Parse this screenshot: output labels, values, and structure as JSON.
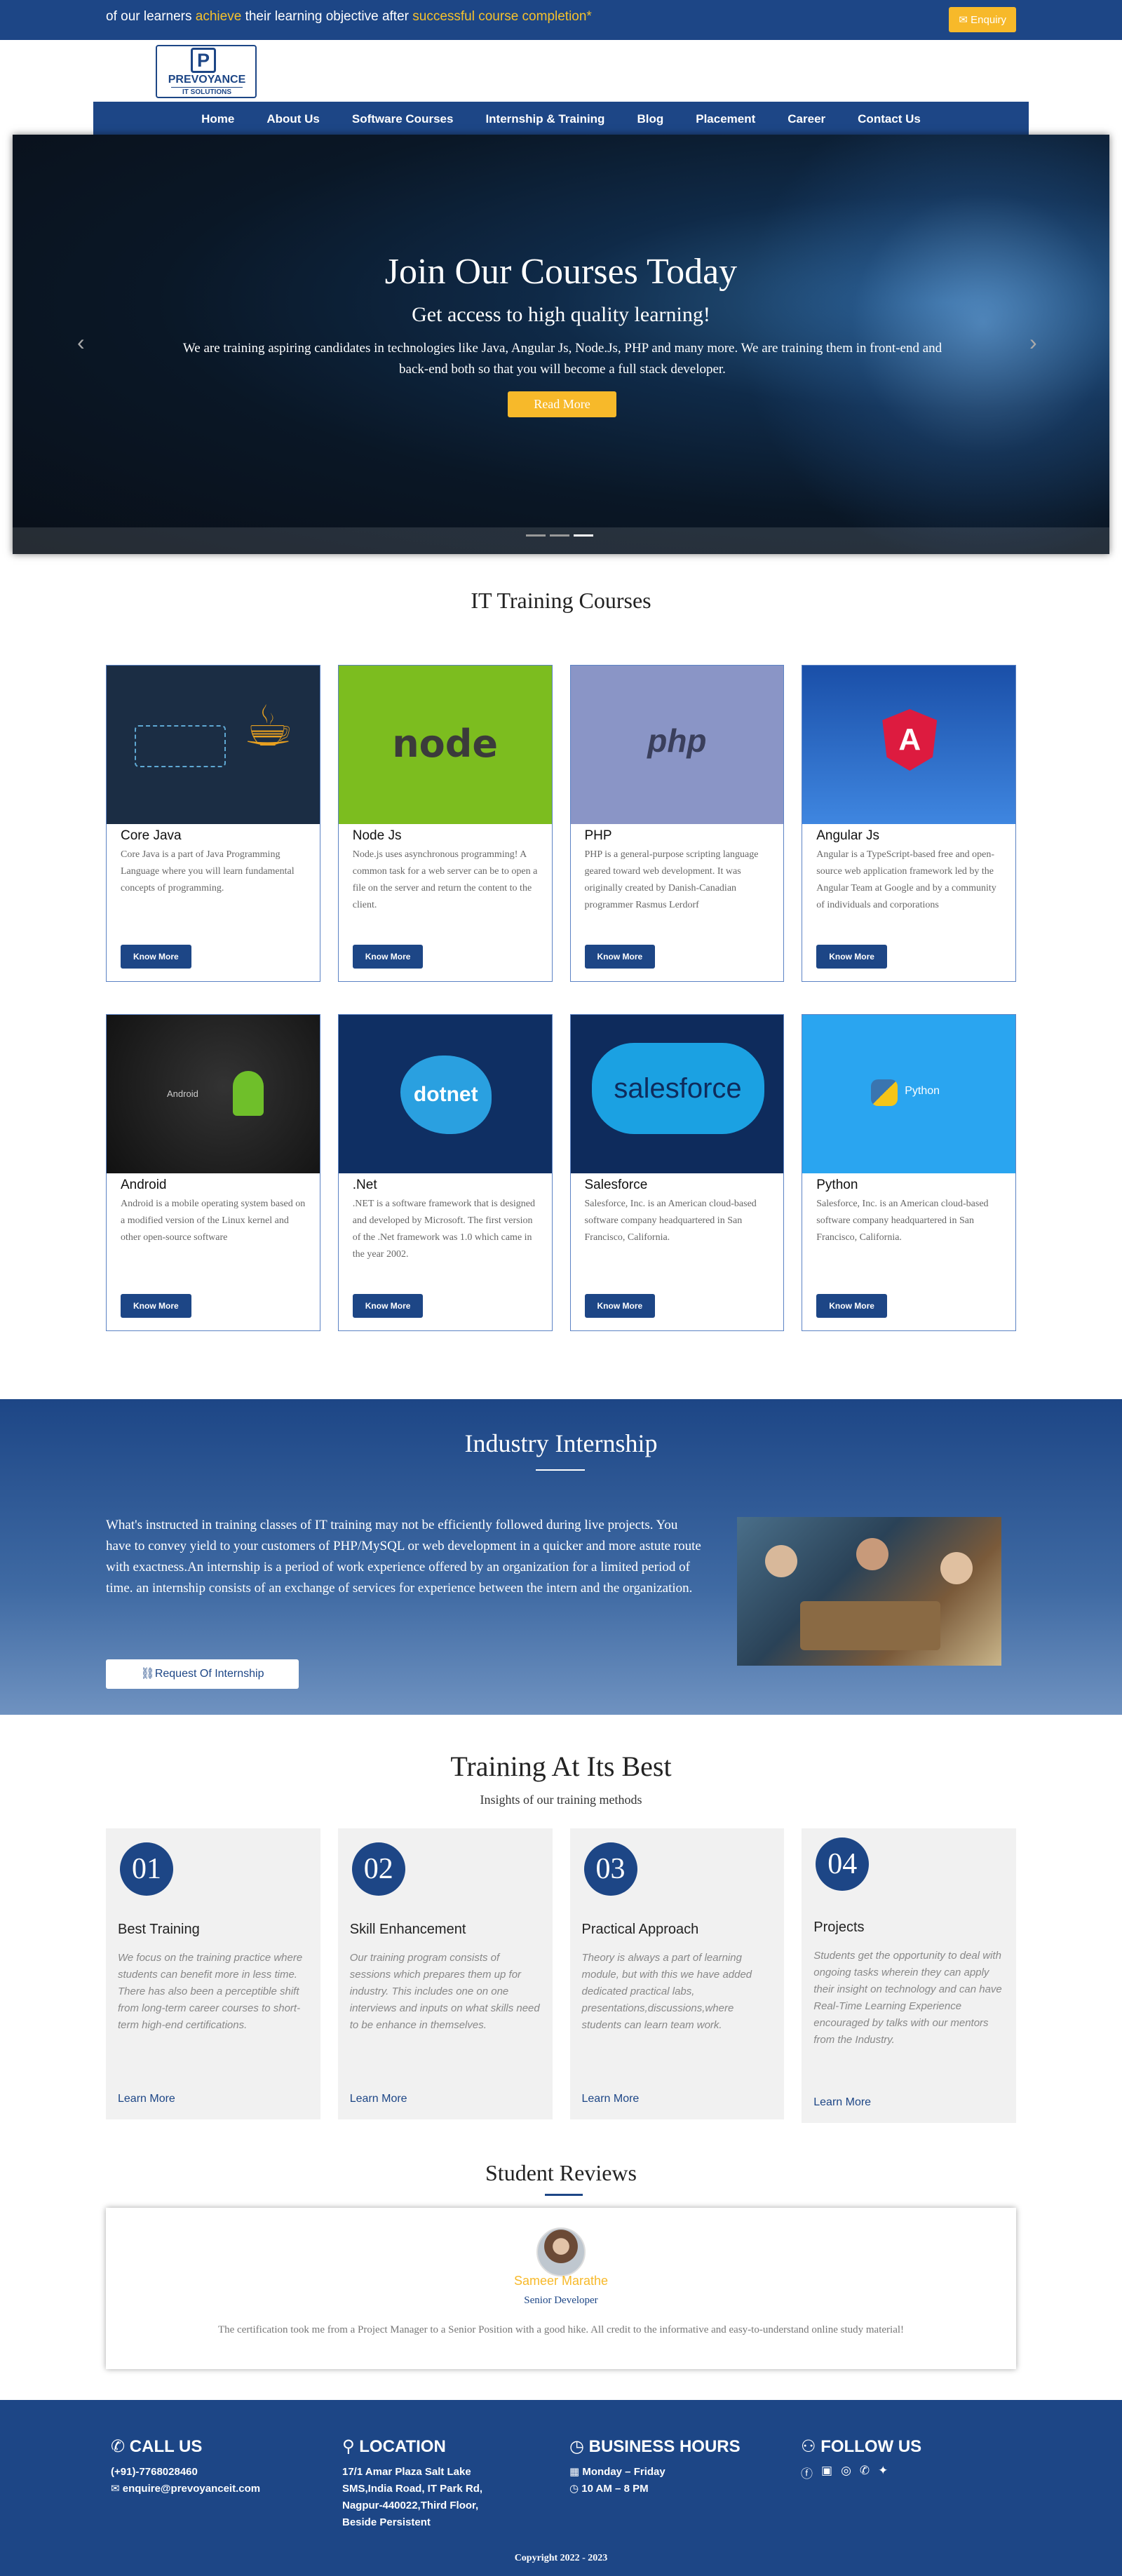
{
  "topbar": {
    "msg_a": "of our learners ",
    "msg_hl1": "achieve",
    "msg_b": " their learning objective after ",
    "msg_hl2": "successful course completion*",
    "enquiry": "✉ Enquiry"
  },
  "logo": {
    "letter": "P",
    "line1": "PREVOYANCE",
    "line2": "IT SOLUTIONS"
  },
  "nav": [
    "Home",
    "About Us",
    "Software Courses",
    "Internship & Training",
    "Blog",
    "Placement",
    "Career",
    "Contact Us"
  ],
  "hero": {
    "title": "Join Our Courses Today",
    "subtitle": "Get access to high quality learning!",
    "text": "We are training aspiring candidates in technologies like Java, Angular Js, Node.Js, PHP and many more. We are training them in front-end and back-end both so that you will become a full stack developer.",
    "button": "Read More",
    "prev": "‹",
    "next": "›"
  },
  "courses_title": "IT Training Courses",
  "courses": [
    {
      "title": "Core Java",
      "desc": "Core Java is a part of Java Programming Language where you will learn fundamental concepts of programming.",
      "btn": "Know More",
      "img_text": "",
      "bg": "#1b2d44"
    },
    {
      "title": "Node Js",
      "desc": "Node.js uses asynchronous programming! A common task for a web server can be to open a file on the server and return the content to the client.",
      "btn": "Know More",
      "img_text": "node",
      "bg": "#7cbd1f"
    },
    {
      "title": "PHP",
      "desc": "PHP is a general-purpose scripting language geared toward web development. It was originally created by Danish-Canadian programmer Rasmus Lerdorf",
      "btn": "Know More",
      "img_text": "php",
      "bg": "#8a95c6"
    },
    {
      "title": "Angular Js",
      "desc": "Angular is a TypeScript-based free and open-source web application framework led by the Angular Team at Google and by a community of individuals and corporations",
      "btn": "Know More",
      "img_text": "A",
      "bg": "#2a64c0"
    },
    {
      "title": "Android",
      "desc": "Android is a mobile operating system based on a modified version of the Linux kernel and other open-source software",
      "btn": "Know More",
      "img_text": "Android",
      "bg": "#151515"
    },
    {
      "title": ".Net",
      "desc": ".NET is a software framework that is designed and developed by Microsoft. The first version of the .Net framework was 1.0 which came in the year 2002.",
      "btn": "Know More",
      "img_text": "dotnet",
      "bg": "#0f2f63"
    },
    {
      "title": "Salesforce",
      "desc": "Salesforce, Inc. is an American cloud-based software company headquartered in San Francisco, California.",
      "btn": "Know More",
      "img_text": "salesforce",
      "bg": "#0e2b5c"
    },
    {
      "title": "Python",
      "desc": "Salesforce, Inc. is an American cloud-based software company headquartered in San Francisco, California.",
      "btn": "Know More",
      "img_text": "Python",
      "bg": "#2aa5f0"
    }
  ],
  "internship": {
    "title": "Industry Internship",
    "text": "What's instructed in training classes of IT training may not be efficiently followed during live projects. You have to convey yield to your customers of PHP/MySQL or web development in a quicker and more astute route with exactness.An internship is a period of work experience offered by an organization for a limited period of time. an internship consists of an exchange of services for experience between the intern and the organization.",
    "button": "⛓Request Of Internship"
  },
  "best": {
    "title": "Training At Its Best",
    "subtitle": "Insights of our training methods",
    "items": [
      {
        "num": "01",
        "title": "Best Training",
        "desc": "We focus on the training practice where students can benefit more in less time. There has also been a perceptible shift from long-term career courses to short-term high-end certifications.",
        "link": "Learn More"
      },
      {
        "num": "02",
        "title": "Skill Enhancement",
        "desc": "Our training program consists of sessions which prepares them up for industry. This includes one on one interviews and inputs on what skills need to be enhance in themselves.",
        "link": "Learn More"
      },
      {
        "num": "03",
        "title": "Practical Approach",
        "desc": "Theory is always a part of learning module, but with this we have added dedicated practical labs, presentations,discussions,where students can learn team work.",
        "link": "Learn More"
      },
      {
        "num": "04",
        "title": "Projects",
        "desc": "Students get the opportunity to deal with ongoing tasks wherein they can apply their insight on technology and can have Real-Time Learning Experience encouraged by talks with our mentors from the Industry.",
        "link": "Learn More"
      }
    ]
  },
  "reviews": {
    "title": "Student Reviews",
    "name": "Sameer Marathe",
    "role": "Senior Developer",
    "text": "The certification took me from a Project Manager to a Senior Position with a good hike. All credit to the informative and easy-to-understand online study material!"
  },
  "footer": {
    "call_title": "CALL US",
    "phone": "(+91)-7768028460",
    "email": "enquire@prevoyanceit.com",
    "loc_title": "LOCATION",
    "address": [
      "17/1 Amar Plaza Salt Lake",
      "SMS,India Road, IT Park Rd,",
      "Nagpur-440022,Third Floor,",
      "Beside Persistent"
    ],
    "hours_title": "BUSINESS HOURS",
    "days": "Monday – Friday",
    "time": "10 AM – 8 PM",
    "follow_title": "FOLLOW US",
    "copyright": "Copyright 2022 - 2023"
  }
}
